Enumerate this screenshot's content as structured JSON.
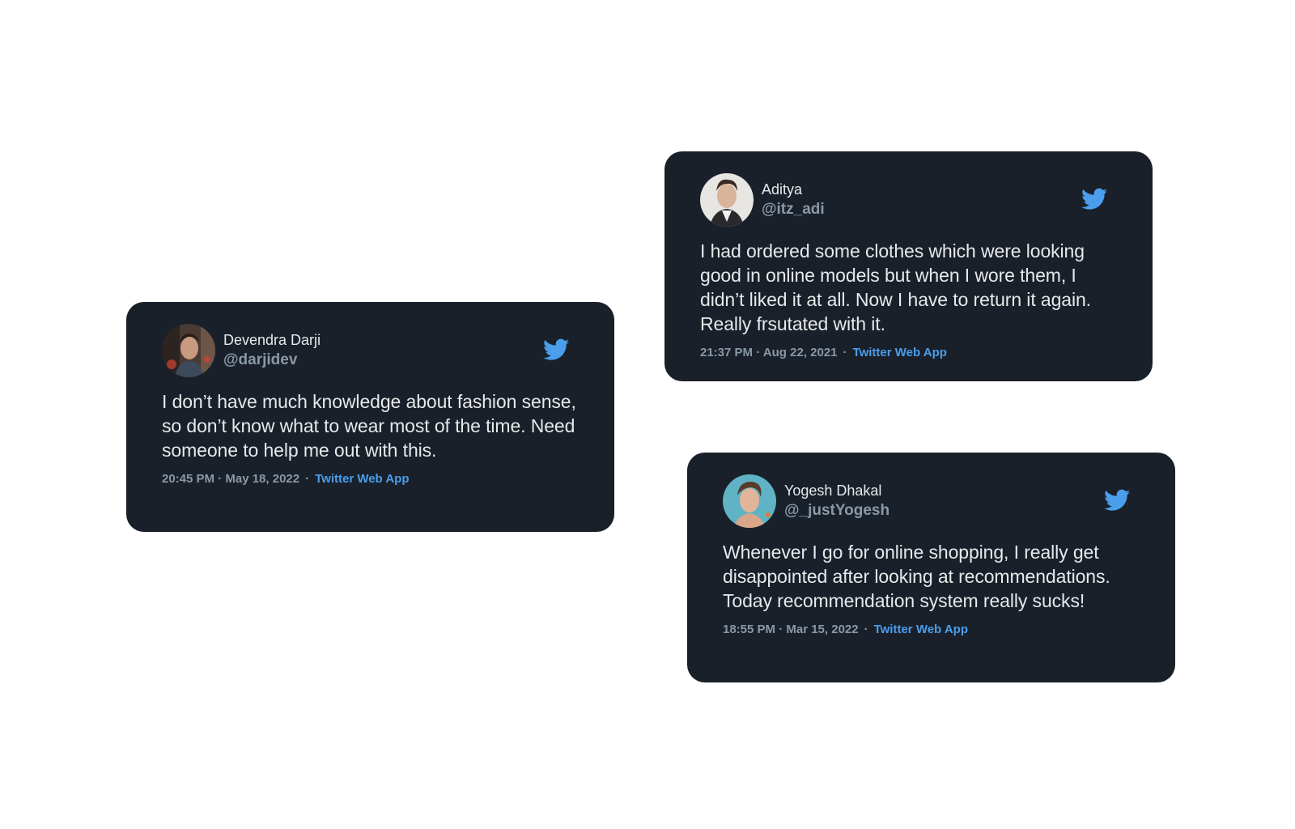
{
  "colors": {
    "card_background": "#19202a",
    "text_primary": "#e7e9ea",
    "text_secondary": "#8b98a5",
    "twitter_blue": "#4a9eeb"
  },
  "tweets": [
    {
      "name": "Devendra Darji",
      "handle": "@darjidev",
      "text": "I don’t have much knowledge about fashion sense, so don’t know what to wear most of the time. Need someone to help me out with this.",
      "timestamp": "20:45 PM · May 18, 2022",
      "separator": "·",
      "source": "Twitter Web App",
      "avatar_icon": "avatar-photo",
      "logo_icon": "twitter-bird-icon"
    },
    {
      "name": "Aditya",
      "handle": "@itz_adi",
      "text": "I had ordered some clothes which were looking good in online models but when I wore them, I didn’t liked it at all. Now I have to return it again. Really frsutated with it.",
      "timestamp": "21:37 PM · Aug 22, 2021",
      "separator": "·",
      "source": "Twitter Web App",
      "avatar_icon": "avatar-photo",
      "logo_icon": "twitter-bird-icon"
    },
    {
      "name": "Yogesh Dhakal",
      "handle": "@_justYogesh",
      "text": "Whenever I go for online shopping, I really get disappointed after looking at recommendations. Today recommendation system really sucks!",
      "timestamp": "18:55 PM · Mar 15, 2022",
      "separator": "·",
      "source": "Twitter Web App",
      "avatar_icon": "avatar-photo",
      "logo_icon": "twitter-bird-icon"
    }
  ]
}
